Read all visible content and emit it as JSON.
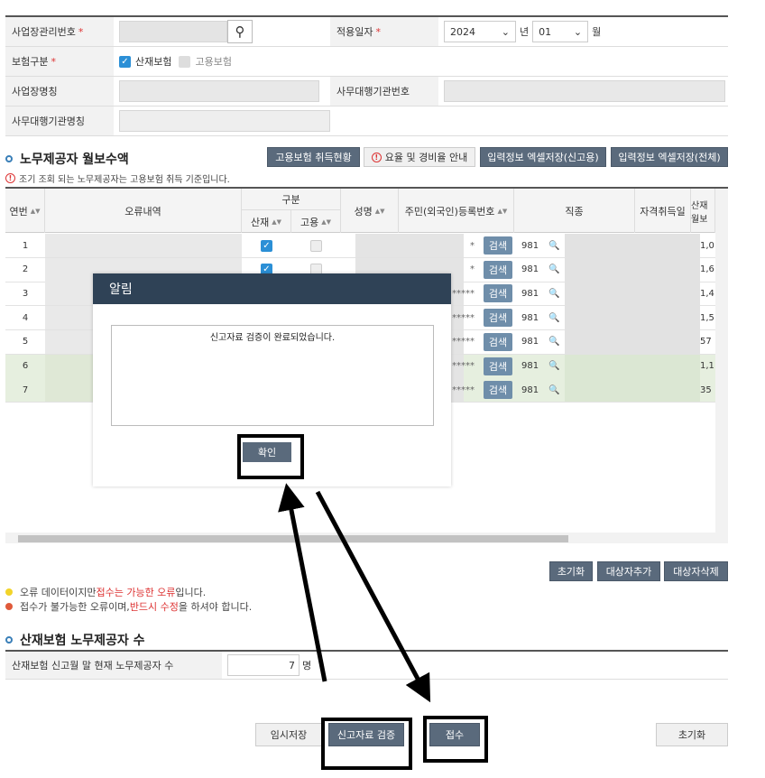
{
  "form": {
    "biz_no_label": "사업장관리번호",
    "apply_date_label": "적용일자",
    "year_value": "2024",
    "year_unit": "년",
    "month_value": "01",
    "month_unit": "월",
    "insurance_type_label": "보험구분",
    "industrial_label": "산재보험",
    "employment_label": "고용보험",
    "biz_name_label": "사업장명칭",
    "agency_no_label": "사무대행기관번호",
    "agency_name_label": "사무대행기관명칭",
    "required_mark": "*"
  },
  "section1": {
    "title": "노무제공자 월보수액",
    "notice": "조기 조회 되는 노무제공자는 고용보험 취득 기준입니다.",
    "btn_status": "고용보험 취득현황",
    "btn_rate": "요율 및 경비율 안내",
    "btn_excel_report": "입력정보 엑셀저장(신고용)",
    "btn_excel_all": "입력정보 엑셀저장(전체)"
  },
  "grid": {
    "headers": {
      "seq": "연번",
      "error": "오류내역",
      "category": "구분",
      "industrial": "산재",
      "employment": "고용",
      "name": "성명",
      "rrn": "주민(외국인)등록번호",
      "job": "직종",
      "qualify": "자격취득일",
      "wage": "산재 월보"
    },
    "search_label": "검색",
    "rows": [
      {
        "seq": "1",
        "rrn": "*",
        "job_code": "981",
        "wage": "1,0"
      },
      {
        "seq": "2",
        "rrn": "*",
        "job_code": "981",
        "wage": "1,6"
      },
      {
        "seq": "3",
        "rrn": "*****",
        "job_code": "981",
        "wage": "1,4"
      },
      {
        "seq": "4",
        "rrn": "*****",
        "job_code": "981",
        "wage": "1,5"
      },
      {
        "seq": "5",
        "rrn": "*****",
        "job_code": "981",
        "wage": "57"
      },
      {
        "seq": "6",
        "rrn": "*****",
        "job_code": "981",
        "wage": "1,1"
      },
      {
        "seq": "7",
        "rrn": "*****",
        "job_code": "981",
        "wage": "35"
      }
    ]
  },
  "grid_buttons": {
    "reset": "초기화",
    "add": "대상자추가",
    "delete": "대상자삭제"
  },
  "legend": {
    "yellow_prefix": "오류 데이터이지만 ",
    "yellow_red": "접수는 가능한 오류",
    "yellow_suffix": "입니다.",
    "red_prefix": "접수가 불가능한 오류이며, ",
    "red_red": "반드시 수정",
    "red_suffix": "을 하셔야 합니다."
  },
  "section2": {
    "title": "산재보험 노무제공자 수",
    "label": "산재보험 신고월 말 현재 노무제공자 수",
    "value": "7",
    "unit": "명"
  },
  "bottom": {
    "temp_save": "임시저장",
    "verify": "신고자료 검증",
    "submit": "접수",
    "reset": "초기화"
  },
  "modal": {
    "title": "알림",
    "message": "신고자료 검증이 완료되었습니다.",
    "confirm": "확인"
  }
}
